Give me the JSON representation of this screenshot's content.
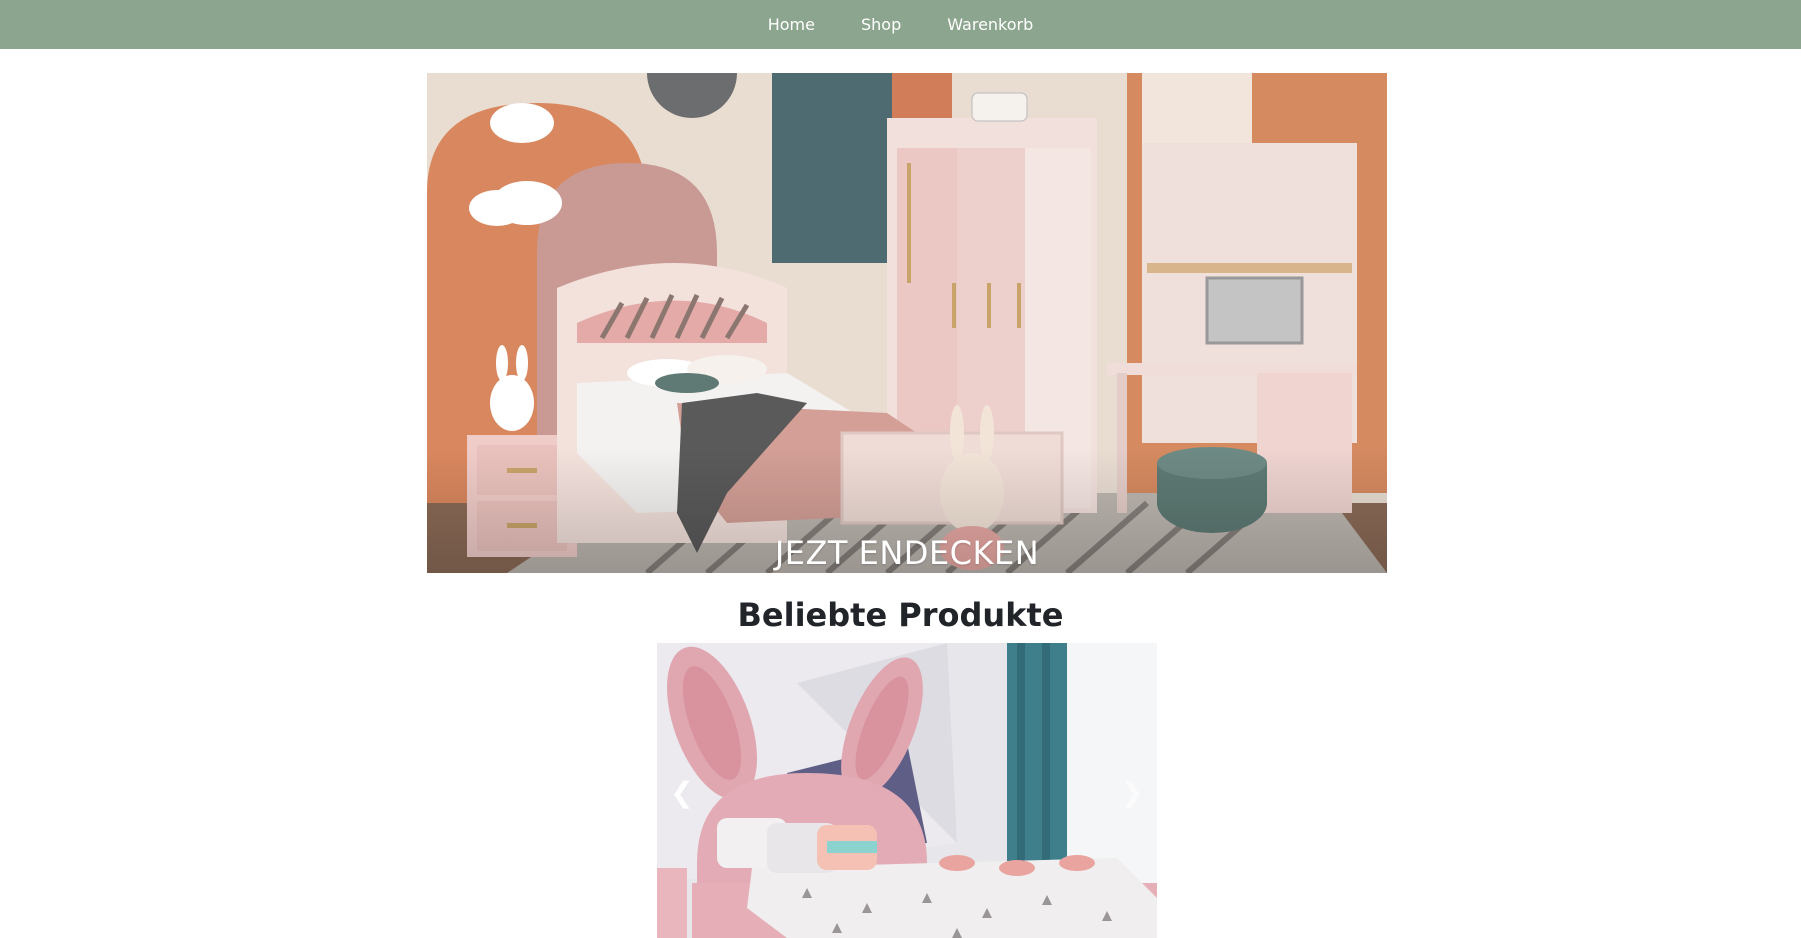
{
  "nav": {
    "items": [
      {
        "label": "Home"
      },
      {
        "label": "Shop"
      },
      {
        "label": "Warenkorb"
      }
    ]
  },
  "hero": {
    "cta_label": "JEZT ENDECKEN",
    "image_icon": "kids-bedroom-photo"
  },
  "popular": {
    "title": "Beliebte Produkte",
    "carousel": {
      "prev_label": "❮",
      "next_label": "❯",
      "image_icon": "bunny-bed-photo"
    }
  },
  "colors": {
    "nav_bg": "#8ca58e",
    "nav_text": "#ffffff"
  }
}
